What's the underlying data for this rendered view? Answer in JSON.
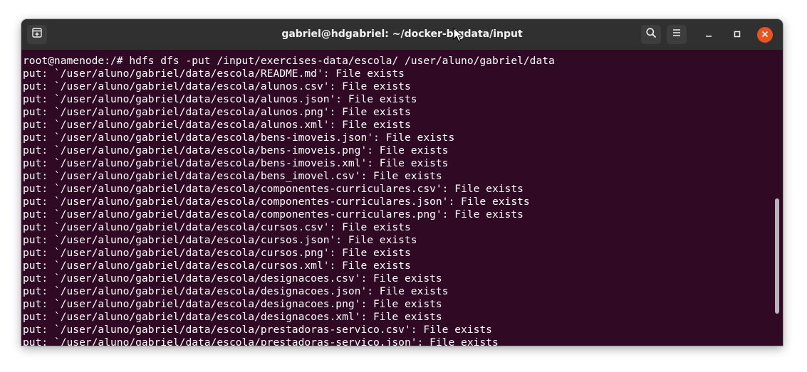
{
  "window": {
    "title": "gabriel@hdgabriel: ~/docker-bigdata/input"
  },
  "icons": {
    "new_tab": "new-tab-icon",
    "search": "search-icon",
    "menu": "hamburger-menu-icon",
    "minimize": "minimize-icon",
    "maximize": "maximize-icon",
    "close": "close-icon"
  },
  "colors": {
    "terminal_bg": "#300a24",
    "titlebar_bg": "#303030",
    "close_accent": "#e95420",
    "text": "#ffffff"
  },
  "terminal": {
    "lines": [
      "root@namenode:/# hdfs dfs -put /input/exercises-data/escola/ /user/aluno/gabriel/data",
      "put: `/user/aluno/gabriel/data/escola/README.md': File exists",
      "put: `/user/aluno/gabriel/data/escola/alunos.csv': File exists",
      "put: `/user/aluno/gabriel/data/escola/alunos.json': File exists",
      "put: `/user/aluno/gabriel/data/escola/alunos.png': File exists",
      "put: `/user/aluno/gabriel/data/escola/alunos.xml': File exists",
      "put: `/user/aluno/gabriel/data/escola/bens-imoveis.json': File exists",
      "put: `/user/aluno/gabriel/data/escola/bens-imoveis.png': File exists",
      "put: `/user/aluno/gabriel/data/escola/bens-imoveis.xml': File exists",
      "put: `/user/aluno/gabriel/data/escola/bens_imovel.csv': File exists",
      "put: `/user/aluno/gabriel/data/escola/componentes-curriculares.csv': File exists",
      "put: `/user/aluno/gabriel/data/escola/componentes-curriculares.json': File exists",
      "put: `/user/aluno/gabriel/data/escola/componentes-curriculares.png': File exists",
      "put: `/user/aluno/gabriel/data/escola/cursos.csv': File exists",
      "put: `/user/aluno/gabriel/data/escola/cursos.json': File exists",
      "put: `/user/aluno/gabriel/data/escola/cursos.png': File exists",
      "put: `/user/aluno/gabriel/data/escola/cursos.xml': File exists",
      "put: `/user/aluno/gabriel/data/escola/designacoes.csv': File exists",
      "put: `/user/aluno/gabriel/data/escola/designacoes.json': File exists",
      "put: `/user/aluno/gabriel/data/escola/designacoes.png': File exists",
      "put: `/user/aluno/gabriel/data/escola/designacoes.xml': File exists",
      "put: `/user/aluno/gabriel/data/escola/prestadoras-servico.csv': File exists",
      "put: `/user/aluno/gabriel/data/escola/prestadoras-servico.json': File exists"
    ]
  }
}
